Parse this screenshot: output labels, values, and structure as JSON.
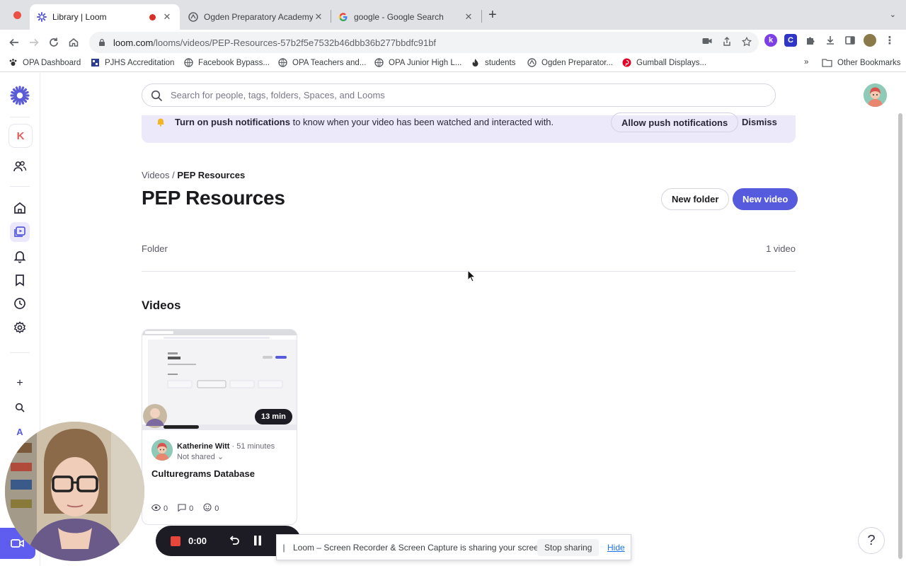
{
  "browser": {
    "tabs": [
      {
        "title": "Library | Loom",
        "favicon": "loom-icon",
        "recording": true
      },
      {
        "title": "Ogden Preparatory Academy -",
        "favicon": "opa-icon"
      },
      {
        "title": "google - Google Search",
        "favicon": "google-icon"
      }
    ],
    "url_host": "loom.com",
    "url_path": "/looms/videos/PEP-Resources-57b2f5e7532b46dbb36b277bbdfc91bf",
    "bookmarks": [
      "OPA Dashboard",
      "PJHS Accreditation",
      "Facebook Bypass...",
      "OPA Teachers and...",
      "OPA Junior High L...",
      "students",
      "Ogden Preparator...",
      "Gumball Displays..."
    ],
    "bookmarks_more": "»",
    "other_bookmarks": "Other Bookmarks"
  },
  "rail": {
    "workspace_initial": "K",
    "bottom_initial": "A",
    "plus": "+"
  },
  "search": {
    "placeholder": "Search for people, tags, folders, Spaces, and Looms"
  },
  "banner": {
    "bold": "Turn on push notifications",
    "text": " to know when your video has been watched and interacted with.",
    "allow_label": "Allow push notifications",
    "dismiss_label": "Dismiss"
  },
  "breadcrumb": {
    "root": "Videos",
    "separator": "/",
    "current": "PEP Resources"
  },
  "page": {
    "title": "PEP Resources",
    "new_folder_label": "New folder",
    "new_video_label": "New video",
    "folder_label": "Folder",
    "video_count": "1 video",
    "section_title": "Videos"
  },
  "videos": [
    {
      "duration": "13 min",
      "author": "Katherine Witt",
      "time_ago": "51 minutes",
      "sharing": "Not shared",
      "title": "Culturegrams Database",
      "views": "0",
      "comments": "0",
      "reactions": "0"
    }
  ],
  "recorder": {
    "time": "0:00"
  },
  "share_bar": {
    "message": "Loom – Screen Recorder & Screen Capture is sharing your screen.",
    "stop_label": "Stop sharing",
    "hide_label": "Hide"
  },
  "help": {
    "label": "?"
  },
  "colors": {
    "accent": "#565add",
    "banner_bg": "#ece9fb",
    "record_red": "#e8463b"
  }
}
